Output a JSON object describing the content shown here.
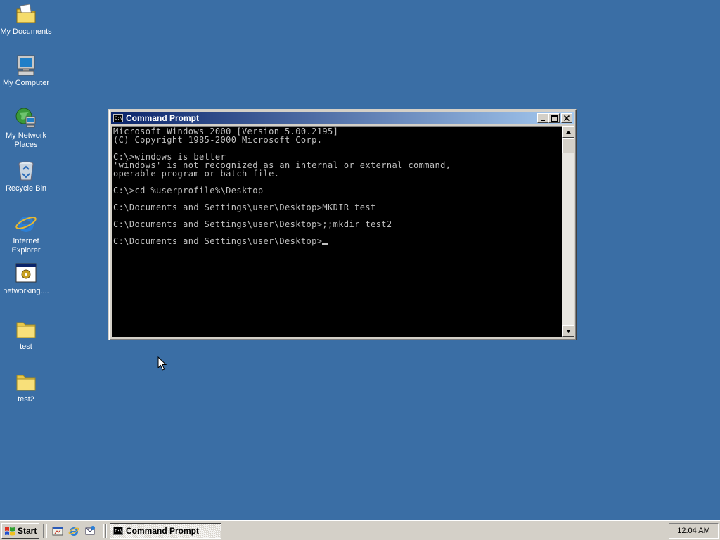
{
  "desktop": {
    "icons": [
      {
        "label": "My Documents",
        "icon": "my-documents-icon"
      },
      {
        "label": "My Computer",
        "icon": "my-computer-icon"
      },
      {
        "label": "My Network",
        "label2": "Places",
        "icon": "network-places-icon"
      },
      {
        "label": "Recycle Bin",
        "icon": "recycle-bin-icon"
      },
      {
        "label": "Internet",
        "label2": "Explorer",
        "icon": "internet-explorer-icon"
      },
      {
        "label": "networking....",
        "icon": "program-file-icon"
      },
      {
        "label": "test",
        "icon": "folder-icon"
      },
      {
        "label": "test2",
        "icon": "folder-icon"
      }
    ]
  },
  "window": {
    "title": "Command Prompt",
    "console_lines": [
      "Microsoft Windows 2000 [Version 5.00.2195]",
      "(C) Copyright 1985-2000 Microsoft Corp.",
      "",
      "C:\\>windows is better",
      "'windows' is not recognized as an internal or external command,",
      "operable program or batch file.",
      "",
      "C:\\>cd %userprofile%\\Desktop",
      "",
      "C:\\Documents and Settings\\user\\Desktop>MKDIR test",
      "",
      "C:\\Documents and Settings\\user\\Desktop>;;mkdir test2",
      "",
      "C:\\Documents and Settings\\user\\Desktop>"
    ]
  },
  "taskbar": {
    "start_label": "Start",
    "task_button_label": "Command Prompt",
    "clock": "12:04 AM"
  },
  "colors": {
    "desktop_bg": "#3a6ea5",
    "titlebar_start": "#0a246a",
    "titlebar_end": "#a6caf0",
    "console_bg": "#000000",
    "console_text": "#c0c0c0"
  }
}
